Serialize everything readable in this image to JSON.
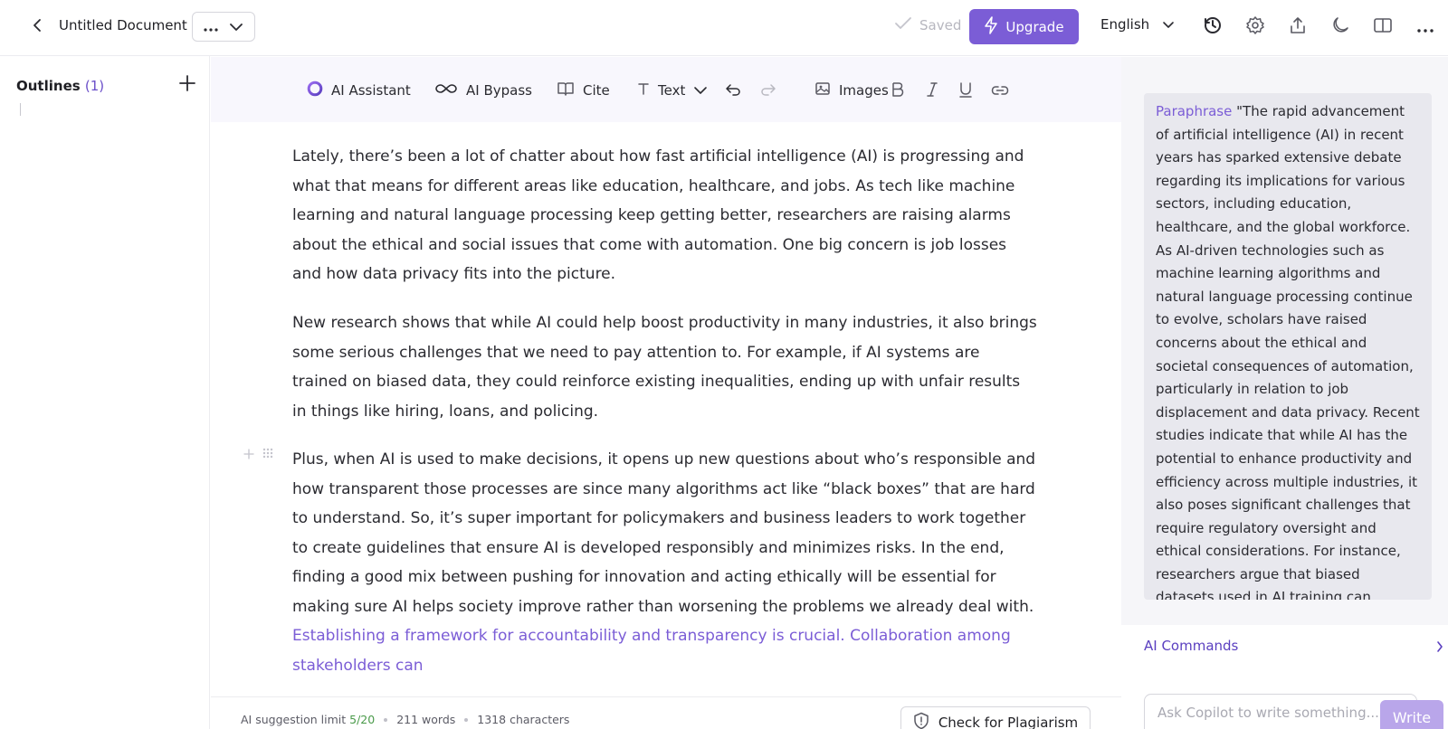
{
  "header": {
    "document_title": "Untitled Document",
    "saved_label": "Saved",
    "upgrade_label": "Upgrade",
    "language": "English",
    "icons": [
      "history-icon",
      "settings-icon",
      "share-icon",
      "dark-mode-icon",
      "layout-icon",
      "more-icon"
    ]
  },
  "sidebar": {
    "outlines_label": "Outlines",
    "outlines_count": "(1)"
  },
  "toolbar": {
    "ai_assistant": "AI Assistant",
    "ai_bypass": "AI Bypass",
    "cite": "Cite",
    "text_style": "Text",
    "images": "Images"
  },
  "editor": {
    "paragraph_1": "Lately, there’s been a lot of chatter about how fast artificial intelligence (AI) is progressing and what that means for different areas like education, healthcare, and jobs. As tech like machine learning and natural language processing keep getting better, researchers are raising alarms about the ethical and social issues that come with automation. One big concern is job losses and how data privacy fits into the picture.",
    "paragraph_2": "New research shows that while AI could help boost productivity in many industries, it also brings some serious challenges that we need to pay attention to. For example, if AI systems are trained on biased data, they could reinforce existing inequalities, ending up with unfair results in things like hiring, loans, and policing.",
    "paragraph_3": "Plus, when AI is used to make decisions, it opens up new questions about who’s responsible and how transparent those processes are since many algorithms act like “black boxes” that are hard to understand. So, it’s super important for policymakers and business leaders to work together to create guidelines that ensure AI is developed responsibly and minimizes risks. In the end, finding a good mix between pushing for innovation and acting ethically will be essential for making sure AI helps society improve rather than worsening the problems we already deal with.",
    "suggestion": "Establishing a framework for accountability and transparency is crucial. Collaboration among stakeholders can"
  },
  "footer": {
    "limit_label": "AI suggestion limit",
    "limit_value": "5/20",
    "words": "211 words",
    "characters": "1318 characters",
    "plagiarism_label": "Check for Plagiarism"
  },
  "right_panel": {
    "command": "Paraphrase",
    "prompt_text": "\"The rapid advancement of artificial intelligence (AI) in recent years has sparked extensive debate regarding its implications for various sectors, including education, healthcare, and the global workforce. As AI-driven technologies such as machine learning algorithms and natural language processing continue to evolve, scholars have raised concerns about the ethical and societal consequences of automation, particularly in relation to job displacement and data privacy. Recent studies indicate that while AI has the potential to enhance productivity and efficiency across multiple industries, it also poses significant challenges that require regulatory oversight and ethical considerations. For instance, researchers argue that biased datasets used in AI training can perpetuate systemic inequalities, leading to unfair",
    "ai_commands_label": "AI Commands",
    "ask_placeholder": "Ask Copilot to write something...",
    "write_label": "Write"
  },
  "colors": {
    "accent": "#7b5dd6",
    "accent_light": "#b9a6ea",
    "limit_green": "#4a9a4a"
  }
}
